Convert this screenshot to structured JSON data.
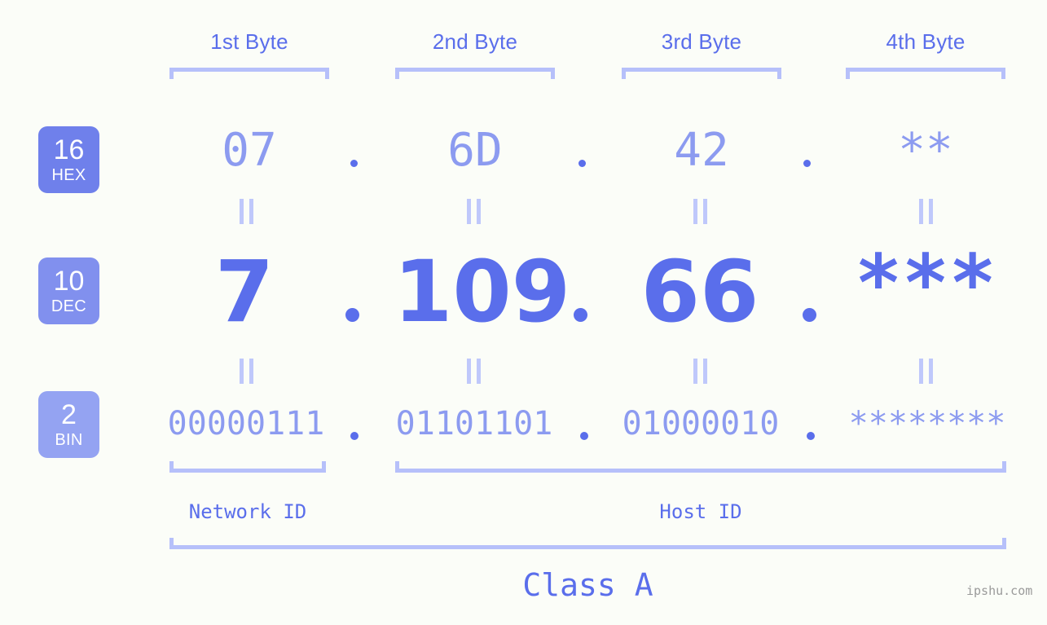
{
  "page": {
    "background_color": "#FBFDF8",
    "accent_color": "#5A6EEB",
    "muted_accent_color": "#8C9BF0",
    "bracket_color": "#B6C0FA",
    "watermark": "ipshu.com"
  },
  "byte_headers": [
    {
      "label": "1st Byte"
    },
    {
      "label": "2nd Byte"
    },
    {
      "label": "3rd Byte"
    },
    {
      "label": "4th Byte"
    }
  ],
  "rows": [
    {
      "badge": {
        "number": "16",
        "name": "HEX",
        "color": "#6F80EB"
      },
      "values": [
        "07",
        "6D",
        "42",
        "**"
      ],
      "separator": "."
    },
    {
      "badge": {
        "number": "10",
        "name": "DEC",
        "color": "#8190EE"
      },
      "values": [
        "7",
        "109",
        "66",
        "***"
      ],
      "separator": "."
    },
    {
      "badge": {
        "number": "2",
        "name": "BIN",
        "color": "#94A3F2"
      },
      "values": [
        "00000111",
        "01101101",
        "01000010",
        "********"
      ],
      "separator": "."
    }
  ],
  "equality_marker": "||",
  "sections": [
    {
      "label": "Network ID"
    },
    {
      "label": "Host ID"
    }
  ],
  "class": {
    "label": "Class A"
  }
}
